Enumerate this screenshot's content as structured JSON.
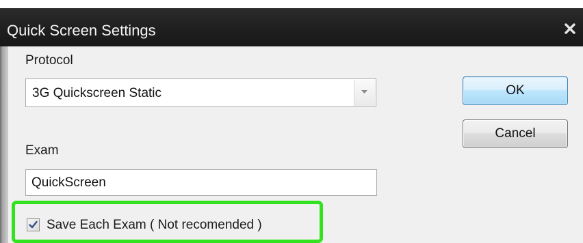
{
  "window": {
    "title": "Quick Screen Settings",
    "close_glyph": "x"
  },
  "protocol": {
    "label": "Protocol",
    "selected": "3G Quickscreen Static"
  },
  "exam": {
    "label": "Exam",
    "value": "QuickScreen"
  },
  "buttons": {
    "ok": "OK",
    "cancel": "Cancel"
  },
  "save_each_exam": {
    "label": "Save Each Exam ( Not recomended )",
    "checked": true
  },
  "colors": {
    "highlight": "#33e21f",
    "titlebar": "#1f1f1f",
    "ok_border": "#3c7fb1"
  },
  "icons": {
    "close": "close-icon",
    "dropdown": "chevron-down-icon",
    "check": "checkmark-icon"
  }
}
